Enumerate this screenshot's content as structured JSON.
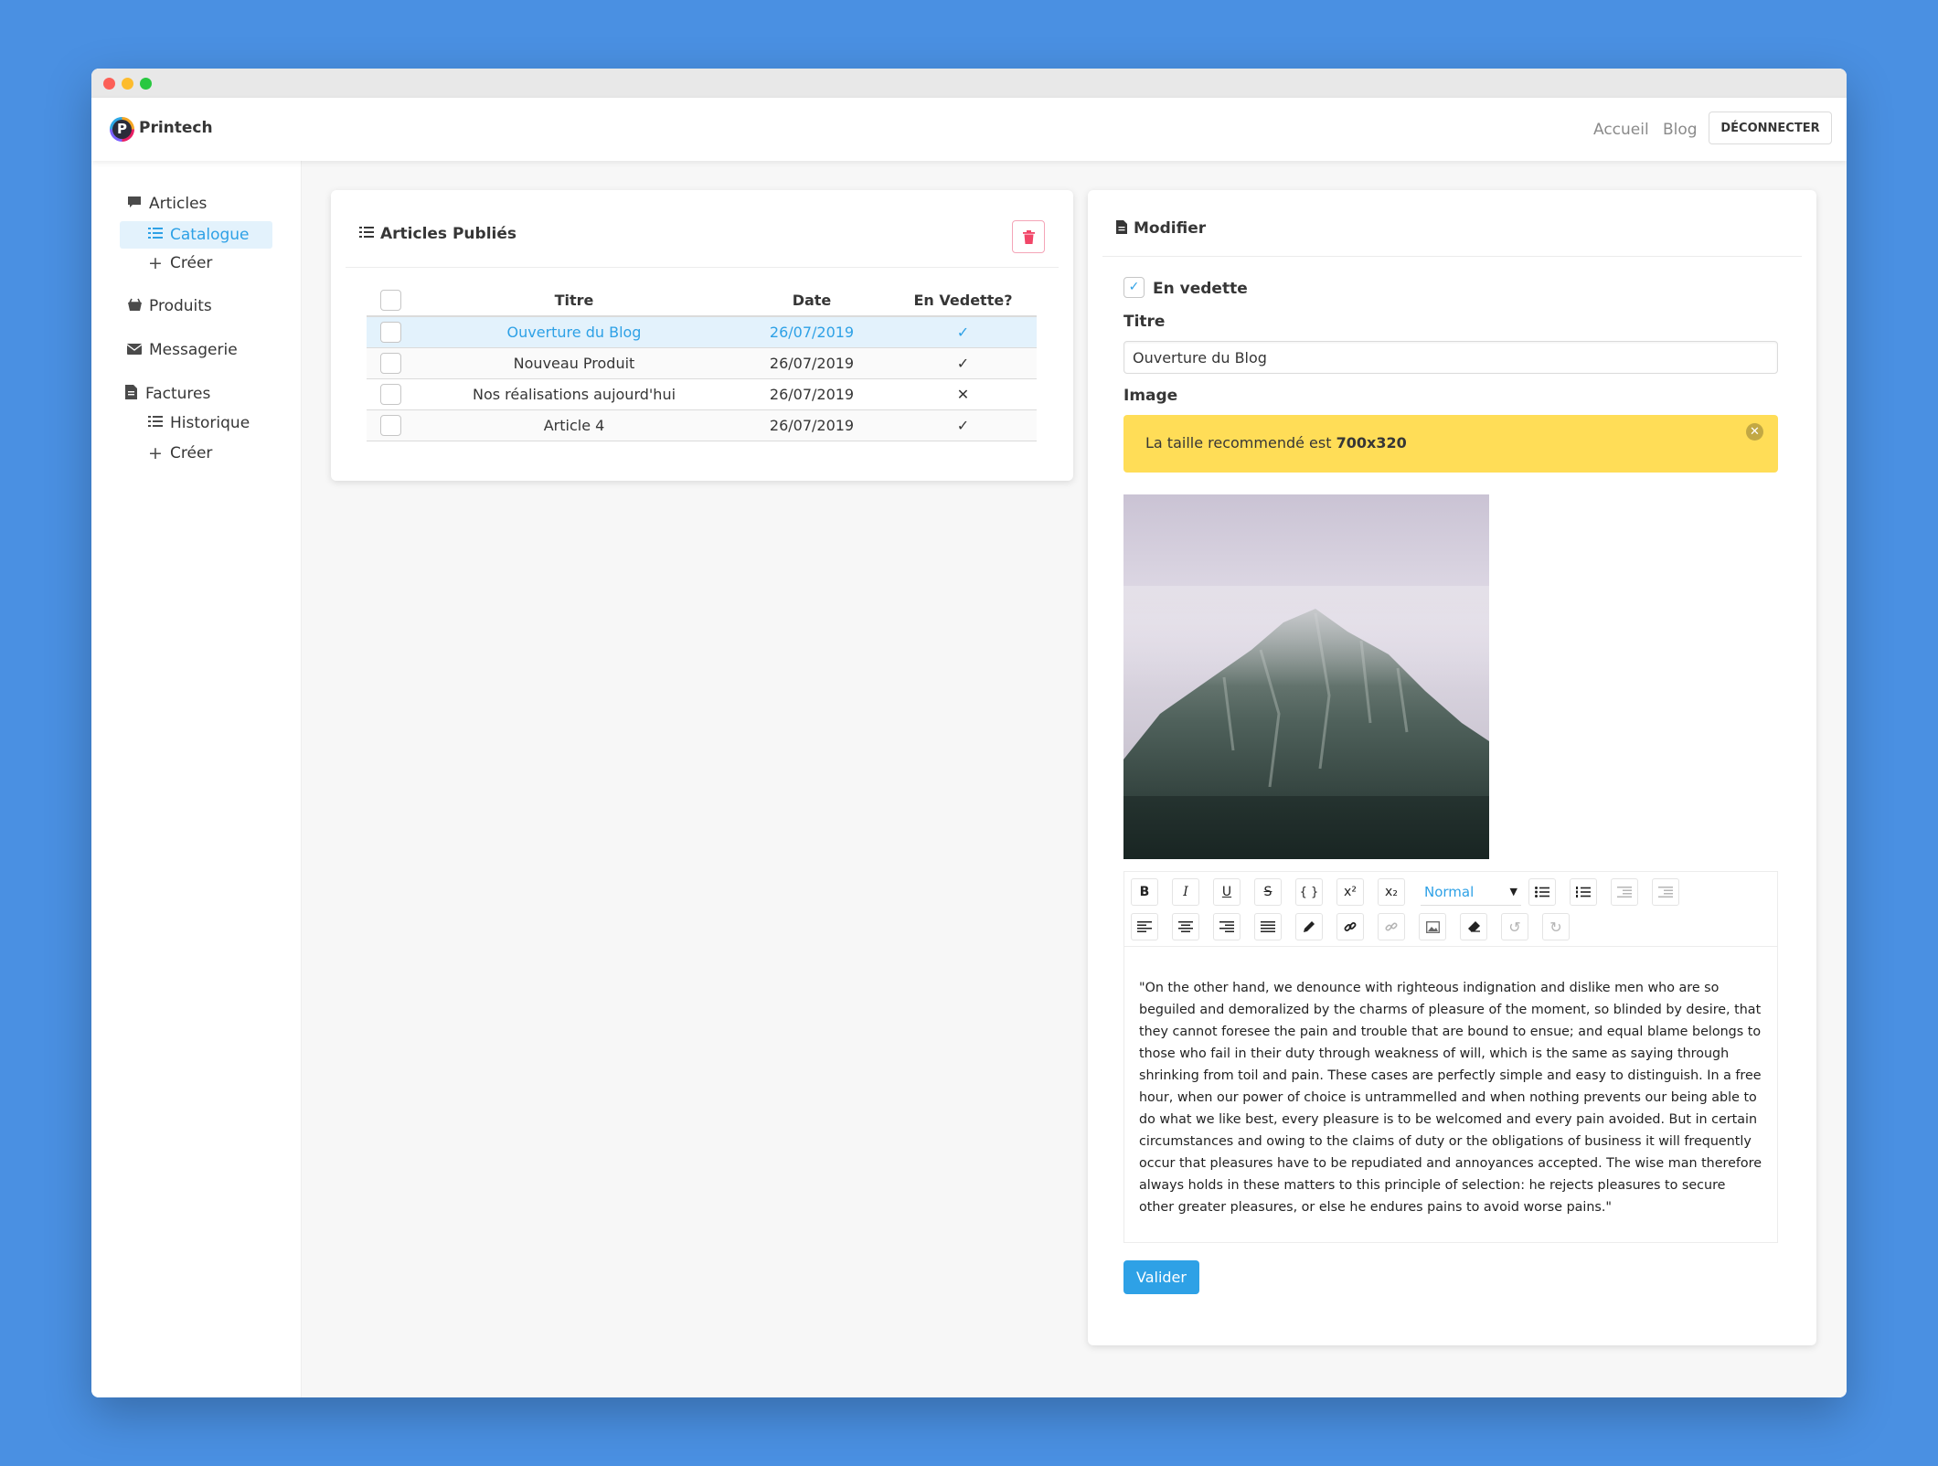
{
  "app": {
    "brand": "Printech",
    "logo_letter": "P"
  },
  "navbar": {
    "links": [
      "Accueil",
      "Blog"
    ],
    "logout_label": "DÉCONNECTER"
  },
  "sidebar": {
    "articles": "Articles",
    "catalogue": "Catalogue",
    "articles_create": "Créer",
    "produits": "Produits",
    "messagerie": "Messagerie",
    "factures": "Factures",
    "historique": "Historique",
    "factures_create": "Créer"
  },
  "articles_panel": {
    "title": "Articles Publiés",
    "columns": [
      "Titre",
      "Date",
      "En Vedette?"
    ],
    "rows": [
      {
        "title": "Ouverture du Blog",
        "date": "26/07/2019",
        "featured": "✓"
      },
      {
        "title": "Nouveau Produit",
        "date": "26/07/2019",
        "featured": "✓"
      },
      {
        "title": "Nos réalisations aujourd'hui",
        "date": "26/07/2019",
        "featured": "✕"
      },
      {
        "title": "Article 4",
        "date": "26/07/2019",
        "featured": "✓"
      }
    ]
  },
  "edit_panel": {
    "title": "Modifier",
    "featured_label": "En vedette",
    "title_label": "Titre",
    "title_value": "Ouverture du Blog",
    "image_label": "Image",
    "notice_text": "La taille recommendé est ",
    "notice_size": "700x320",
    "format_select": "Normal",
    "body_text": "\"On the other hand, we denounce with righteous indignation and dislike men who are so beguiled and demoralized by the charms of pleasure of the moment, so blinded by desire, that they cannot foresee the pain and trouble that are bound to ensue; and equal blame belongs to those who fail in their duty through weakness of will, which is the same as saying through shrinking from toil and pain. These cases are perfectly simple and easy to distinguish. In a free hour, when our power of choice is untrammelled and when nothing prevents our being able to do what we like best, every pleasure is to be welcomed and every pain avoided. But in certain circumstances and owing to the claims of duty or the obligations of business it will frequently occur that pleasures have to be repudiated and annoyances accepted. The wise man therefore always holds in these matters to this principle of selection: he rejects pleasures to secure other greater pleasures, or else he endures pains to avoid worse pains.\"",
    "submit_label": "Valider"
  },
  "colors": {
    "primary": "#2ea1e6",
    "warning": "#ffdd57",
    "danger": "#f14668",
    "background": "#4a90e2"
  }
}
